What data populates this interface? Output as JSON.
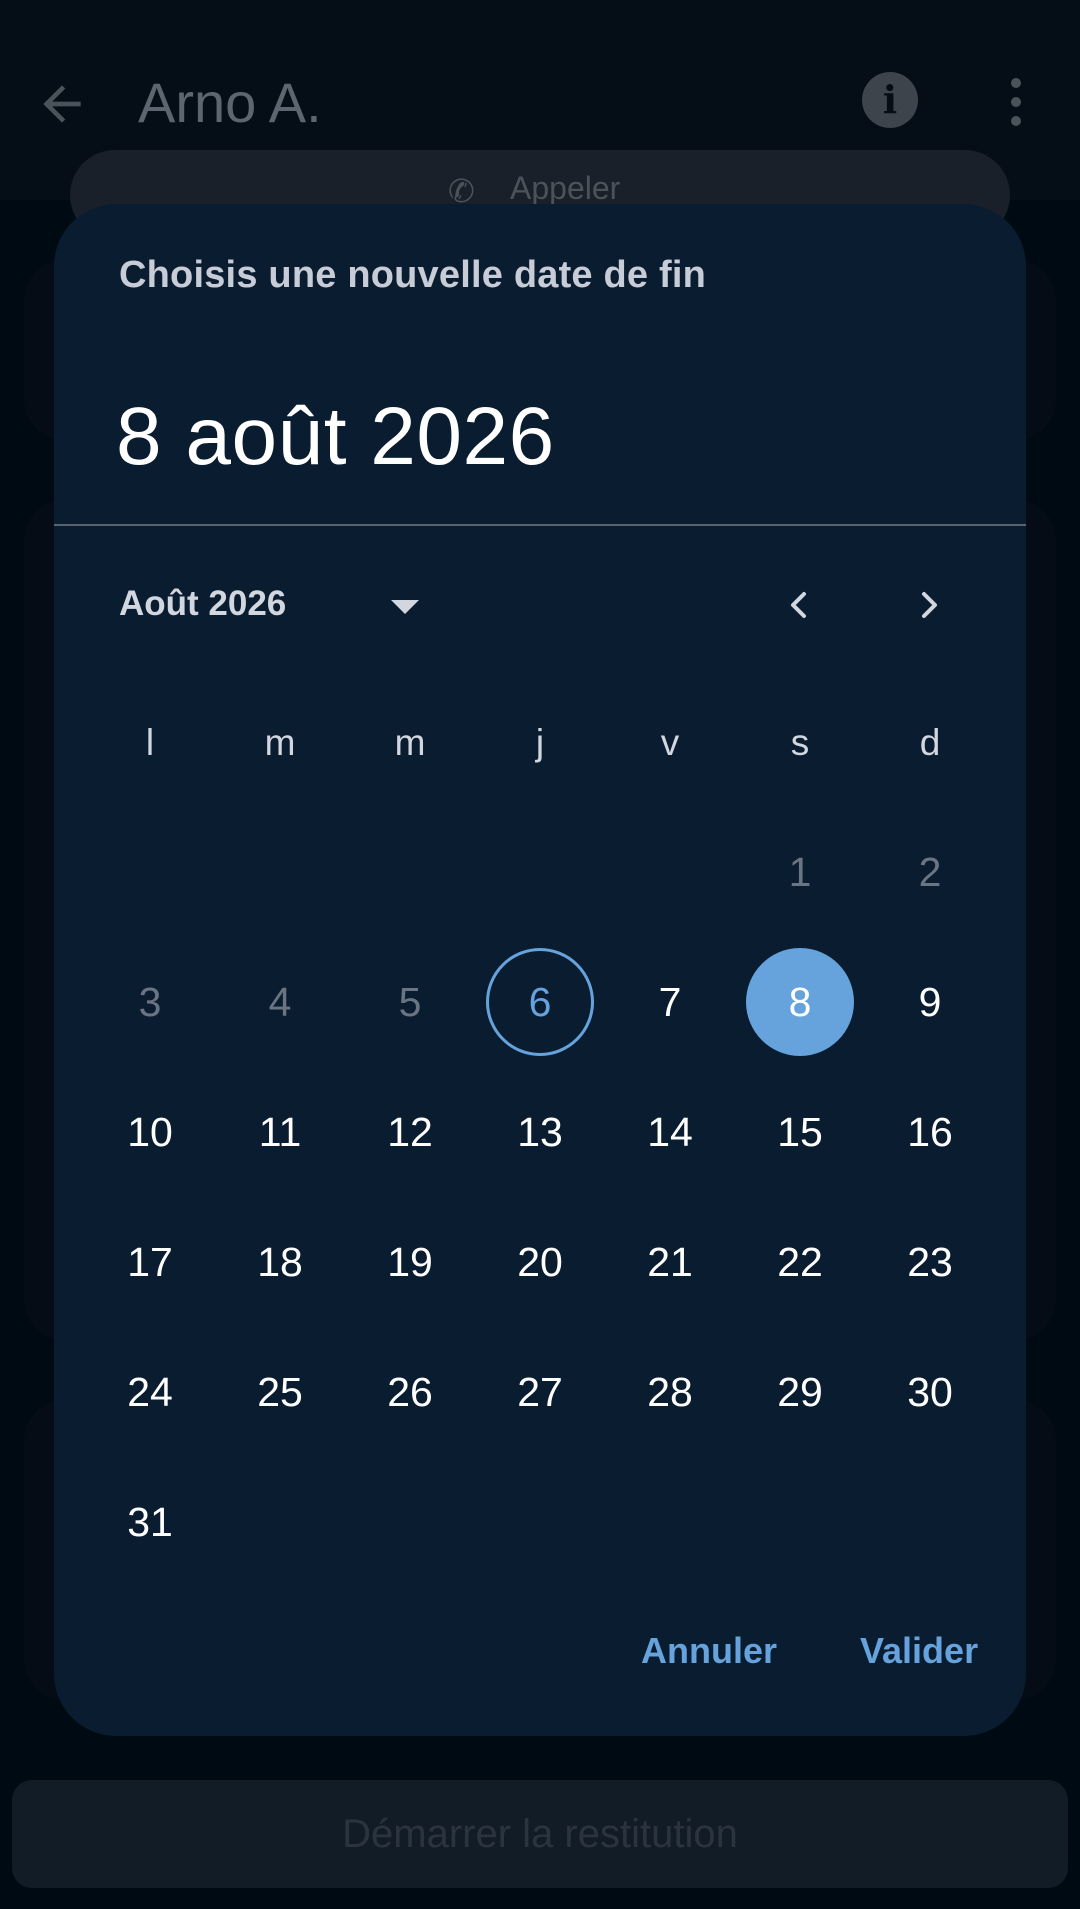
{
  "app": {
    "title": "Arno A.",
    "call_label": "Appeler",
    "start_button": "Démarrer la restitution"
  },
  "dialog": {
    "title": "Choisis une nouvelle date de fin",
    "selected_date": "8 août 2026",
    "month_label": "Août 2026",
    "weekdays": [
      "l",
      "m",
      "m",
      "j",
      "v",
      "s",
      "d"
    ],
    "weeks": [
      [
        null,
        null,
        null,
        null,
        null,
        "1",
        "2"
      ],
      [
        "3",
        "4",
        "5",
        "6",
        "7",
        "8",
        "9"
      ],
      [
        "10",
        "11",
        "12",
        "13",
        "14",
        "15",
        "16"
      ],
      [
        "17",
        "18",
        "19",
        "20",
        "21",
        "22",
        "23"
      ],
      [
        "24",
        "25",
        "26",
        "27",
        "28",
        "29",
        "30"
      ],
      [
        "31",
        null,
        null,
        null,
        null,
        null,
        null
      ]
    ],
    "disabled_days": [
      "1",
      "2",
      "3",
      "4",
      "5"
    ],
    "today": "6",
    "selected": "8",
    "cancel_label": "Annuler",
    "confirm_label": "Valider"
  },
  "colors": {
    "accent": "#66a3dc",
    "dialog_bg": "#0a1c30",
    "scrim_bg": "#000a12"
  },
  "icons": {
    "back": "arrow-left-icon",
    "info": "info-icon",
    "more": "more-vert-icon",
    "dropdown": "triangle-down-icon",
    "prev": "chevron-left-icon",
    "next": "chevron-right-icon"
  }
}
